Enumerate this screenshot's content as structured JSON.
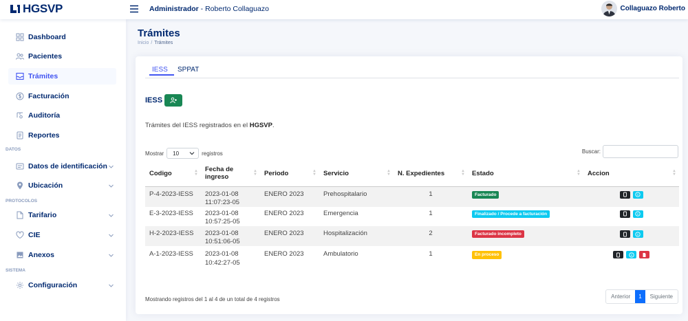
{
  "header": {
    "logo_text": "HGSVP",
    "title_bold": "Administrador",
    "title_rest": " - Roberto Collaguazo",
    "user_name": "Collaguazo Roberto"
  },
  "sidebar": {
    "items": [
      {
        "label": "Dashboard",
        "icon": "grid-icon"
      },
      {
        "label": "Pacientes",
        "icon": "people-icon"
      },
      {
        "label": "Trámites",
        "icon": "inbox-icon"
      },
      {
        "label": "Facturación",
        "icon": "dollar-circle-icon"
      },
      {
        "label": "Auditoría",
        "icon": "magnifier-icon"
      },
      {
        "label": "Reportes",
        "icon": "document-icon"
      },
      {
        "label": "Datos de identificación",
        "icon": "card-icon"
      },
      {
        "label": "Ubicación",
        "icon": "location-pin-icon"
      },
      {
        "label": "Tarifario",
        "icon": "document-icon"
      },
      {
        "label": "CIE",
        "icon": "heart-icon"
      },
      {
        "label": "Anexos",
        "icon": "image-icon"
      },
      {
        "label": "Configuración",
        "icon": "gear-icon"
      }
    ],
    "headings": [
      "DATOS",
      "PROTOCOLOS",
      "SISTEMA"
    ],
    "active_index": 2
  },
  "page": {
    "title": "Trámites",
    "breadcrumb": [
      "Inicio",
      "/",
      "Trámites"
    ]
  },
  "tabs": [
    "IESS",
    "SPPAT"
  ],
  "active_tab": "IESS",
  "section": {
    "title": "IESS",
    "desc_prefix": "Trámites del IESS registrados en el ",
    "desc_bold": "HGSVP",
    "desc_suffix": "."
  },
  "table_controls": {
    "show_label": "Mostrar",
    "page_length": "10",
    "records_label": "registros",
    "search_label": "Buscar:"
  },
  "table": {
    "headers": [
      "Codigo",
      "Fecha de ingreso",
      "Periodo",
      "Servicio",
      "N. Expedientes",
      "Estado",
      "Accion"
    ],
    "rows": [
      {
        "codigo": "P-4-2023-IESS",
        "fecha": "2023-01-08",
        "hora": "11:07:23-05",
        "periodo": "ENERO 2023",
        "servicio": "Prehospitalario",
        "expedientes": "1",
        "estado": "Facturado",
        "estado_color": "#198754"
      },
      {
        "codigo": "E-3-2023-IESS",
        "fecha": "2023-01-08",
        "hora": "10:57:25-05",
        "periodo": "ENERO 2023",
        "servicio": "Emergencia",
        "expedientes": "1",
        "estado": "Finalizado / Procede a facturación",
        "estado_color": "#0dcaf0"
      },
      {
        "codigo": "H-2-2023-IESS",
        "fecha": "2023-01-08",
        "hora": "10:51:06-05",
        "periodo": "ENERO 2023",
        "servicio": "Hospitalización",
        "expedientes": "2",
        "estado": "Facturado incompleto",
        "estado_color": "#dc3545"
      },
      {
        "codigo": "A-1-2023-IESS",
        "fecha": "2023-01-08",
        "hora": "10:42:27-05",
        "periodo": "ENERO 2023",
        "servicio": "Ambulatorio",
        "expedientes": "1",
        "estado": "En proceso",
        "estado_color": "#ffc107"
      }
    ]
  },
  "footer": {
    "info": "Mostrando registros del 1 al 4 de un total de 4 registros",
    "prev": "Anterior",
    "page": "1",
    "next": "Siguiente"
  }
}
